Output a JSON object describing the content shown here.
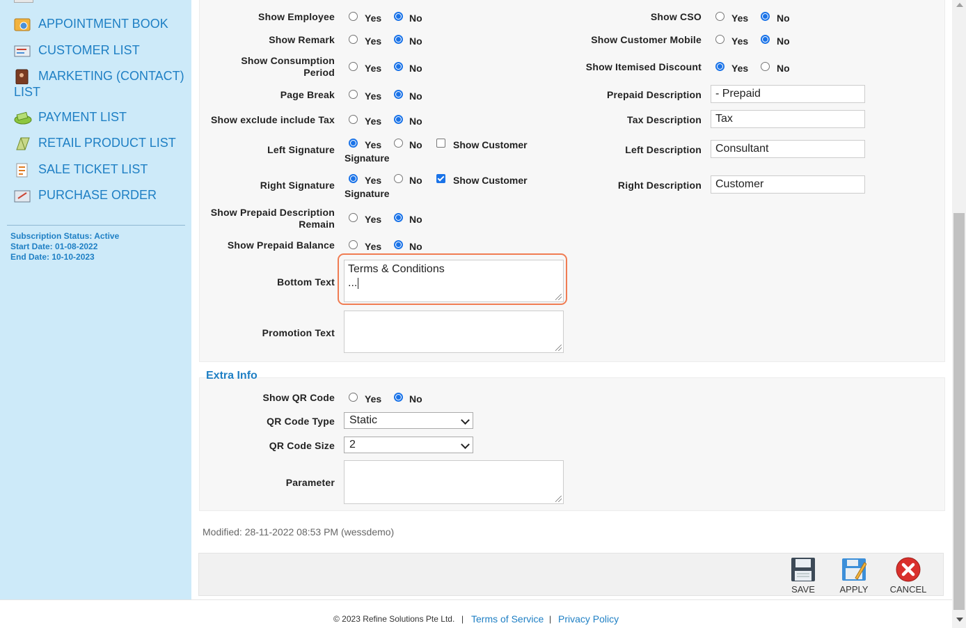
{
  "sidebar": {
    "items": [
      {
        "label": "APPOINTMENT BOOK",
        "icon": "appointment-book-icon"
      },
      {
        "label": "CUSTOMER LIST",
        "icon": "customer-list-icon"
      },
      {
        "label": "MARKETING (CONTACT) LIST",
        "icon": "marketing-contact-icon"
      },
      {
        "label": "PAYMENT LIST",
        "icon": "payment-list-icon"
      },
      {
        "label": "RETAIL PRODUCT LIST",
        "icon": "retail-product-icon"
      },
      {
        "label": "SALE TICKET LIST",
        "icon": "sale-ticket-icon"
      },
      {
        "label": "PURCHASE ORDER",
        "icon": "purchase-order-icon"
      }
    ],
    "subscription": {
      "status": "Subscription Status: Active",
      "start": "Start Date: 01-08-2022",
      "end": "End Date: 10-10-2023"
    }
  },
  "options": {
    "yes": "Yes",
    "no": "No",
    "show_employee": "Show Employee",
    "show_remark": "Show Remark",
    "show_consumption_1": "Show Consumption",
    "show_consumption_2": "Period",
    "page_break": "Page Break",
    "show_exclude_tax": "Show exclude include Tax",
    "left_signature": "Left Signature",
    "right_signature": "Right Signature",
    "show_customer": "Show Customer",
    "signature": "Signature",
    "show_prepaid_desc_1": "Show Prepaid Description",
    "show_prepaid_desc_2": "Remain",
    "show_prepaid_balance": "Show Prepaid Balance",
    "bottom_text": "Bottom Text",
    "promotion_text": "Promotion Text",
    "show_cso": "Show CSO",
    "show_customer_mobile": "Show Customer Mobile",
    "show_itemised_discount": "Show Itemised Discount",
    "prepaid_description": "Prepaid Description",
    "tax_description": "Tax Description",
    "left_description": "Left Description",
    "right_description": "Right Description"
  },
  "values": {
    "prepaid_description": " - Prepaid",
    "tax_description": "Tax",
    "left_description": "Consultant",
    "right_description": "Customer",
    "bottom_text_line1": "Terms & Conditions",
    "bottom_text_line2": "..."
  },
  "extra": {
    "title": "Extra Info",
    "show_qr_code": "Show QR Code",
    "qr_code_type": "QR Code Type",
    "qr_code_type_value": "Static",
    "qr_code_size": "QR Code Size",
    "qr_code_size_value": "2",
    "parameter": "Parameter"
  },
  "modified": "Modified: 28-11-2022 08:53 PM (wessdemo)",
  "actions": {
    "save": "SAVE",
    "apply": "APPLY",
    "cancel": "CANCEL"
  },
  "footer": {
    "copyright": "© 2023 Refine Solutions Pte Ltd.",
    "sep": "|",
    "terms": "Terms of Service",
    "privacy": "Privacy Policy"
  },
  "colors": {
    "accent": "#1a73e8",
    "link": "#1e7fc4",
    "focus": "#f07c52",
    "cancel": "#d9302c"
  }
}
